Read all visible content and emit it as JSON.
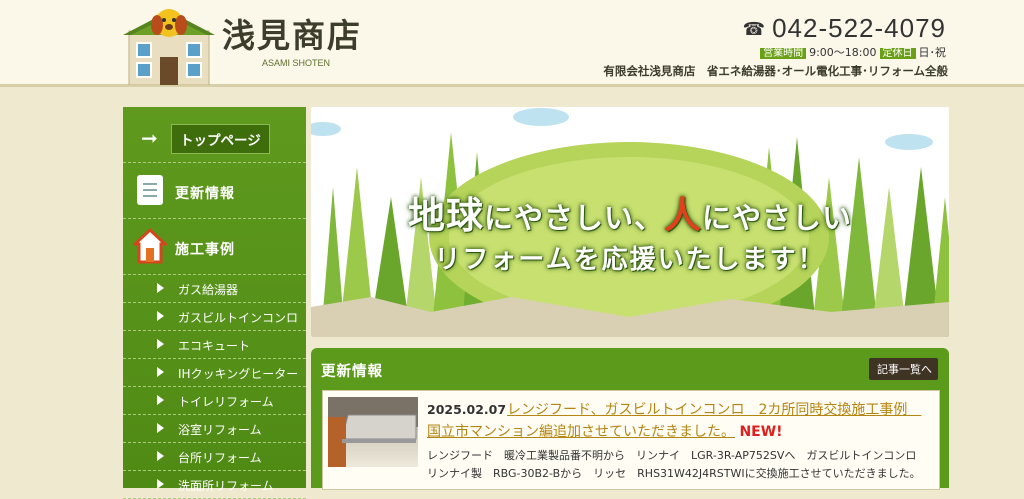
{
  "header": {
    "brand_name": "浅見商店",
    "brand_sub": "ASAMI SHOTEN",
    "phone": "042-522-4079",
    "hours_tag": "営業時間",
    "hours": "9:00〜18:00",
    "holiday_tag": "定休日",
    "holiday": "日･祝",
    "company": "有限会社浅見商店　省エネ給湯器･オール電化工事･リフォーム全般"
  },
  "sidebar": {
    "top": "トップページ",
    "updates": "更新情報",
    "works": "施工事例",
    "items": [
      {
        "label": "ガス給湯器"
      },
      {
        "label": "ガスビルトインコンロ"
      },
      {
        "label": "エコキュート"
      },
      {
        "label": "IHクッキングヒーター"
      },
      {
        "label": "トイレリフォーム"
      },
      {
        "label": "浴室リフォーム"
      },
      {
        "label": "台所リフォーム"
      },
      {
        "label": "洗面所リフォーム"
      }
    ]
  },
  "hero": {
    "p1": "地球",
    "p2": "にやさしい、",
    "p3": "人",
    "p4": "にやさしい",
    "line2": "リフォームを応援いたします！"
  },
  "news": {
    "title": "更新情報",
    "more": "記事一覧へ",
    "date": "2025.02.07",
    "headline": "レンジフード、ガスビルトインコンロ　2カ所同時交換施工事例　国立市マンション編追加させていただきました。",
    "new_badge": "NEW!",
    "body": "レンジフード　暖冷工業製品番不明から　リンナイ　LGR-3R-AP752SVへ　ガスビルトインコンロリンナイ製　RBG-30B2-Bから　リッセ　RHS31W42J4RSTWIに交換施工させていただきました。"
  }
}
